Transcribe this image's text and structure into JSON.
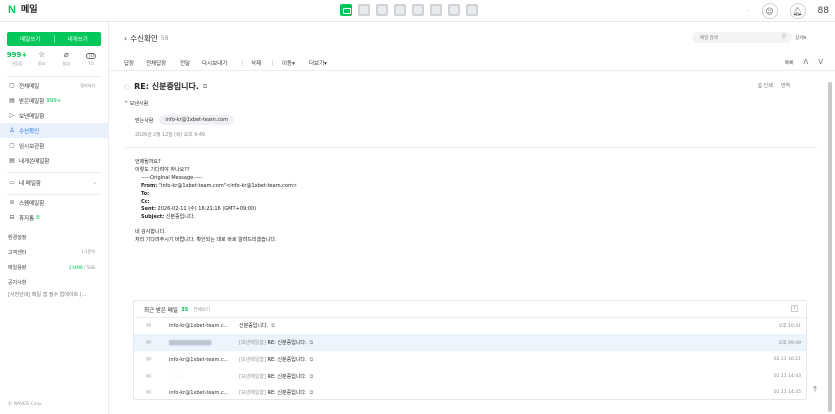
{
  "topbar": {
    "logo_letter": "N",
    "logo_text": "메일",
    "apps": [
      "mail-icon",
      "calendar-icon",
      "note-icon",
      "contacts-icon",
      "drive-icon",
      "memo-icon",
      "board-icon",
      "bookmark-icon"
    ],
    "right_dot": "·",
    "chat_icon": "☺",
    "bell_icon": "♫",
    "grid_icon": "88"
  },
  "sidebar": {
    "write_label": "메일쓰기",
    "self_write_label": "내게쓰기",
    "quick": [
      {
        "value": "999+",
        "label": "안읽음"
      },
      {
        "value": "☆",
        "label": "중요"
      },
      {
        "value": "⌀",
        "label": "첨부"
      },
      {
        "value": "TO",
        "label": "TO"
      }
    ],
    "items": [
      {
        "icon": "▢",
        "label": "전체메일",
        "right": "정리하기"
      },
      {
        "icon": "▤",
        "label": "받은메일함",
        "count": "999+"
      },
      {
        "icon": "▷",
        "label": "보낸메일함"
      },
      {
        "icon": "♙",
        "label": "수신확인"
      },
      {
        "icon": "▢",
        "label": "임시보관함"
      },
      {
        "icon": "▤",
        "label": "내게쓴메일함"
      }
    ],
    "my_folder": {
      "icon": "▭",
      "label": "내 메일함"
    },
    "items2": [
      {
        "icon": "⊘",
        "label": "스팸메일함"
      },
      {
        "icon": "⊟",
        "label": "휴지통",
        "count": "8"
      }
    ],
    "plain": [
      {
        "label": "환경설정"
      },
      {
        "label": "고객센터",
        "right": "1:1문의"
      },
      {
        "label": "메일용량",
        "right_green": "234MB",
        "right_rest": " / 5GB"
      },
      {
        "label": "공지사항"
      },
      {
        "label": "[사전안내] 메일 앱 필수 업데이트 (..."
      }
    ],
    "copyright": "© NAVER Corp."
  },
  "main": {
    "folder_title": "수신확인",
    "folder_count": "58",
    "search_placeholder": "메일 검색",
    "detail_label": "상세▾",
    "toolbar": [
      "답장",
      "전체답장",
      "전달",
      "다시보내기",
      "삭제",
      "이동▾",
      "더보기▾"
    ],
    "list_label": "목록",
    "subject": "RE: 신분증입니다.",
    "print_label": "인쇄",
    "translate_label": "번역",
    "sender_toggle": "보낸사람",
    "recipient_label": "받는사람",
    "recipient": "info-kr@1xbet-team.com",
    "date": "2026년 2월 12일 (목) 오후 9:49",
    "body": {
      "line1": "언제될까요?",
      "line2": "이렇도 기다려야 하나요??",
      "orig": "-----Original Message-----",
      "from_label": "From:",
      "from_value": " \"info-kr@1xbet-team.com\"<info-kr@1xbet-team.com>",
      "to_label": "To:",
      "cc_label": "Cc:",
      "sent_label": "Sent:",
      "sent_value": " 2026-02-11 (수) 16:21:16 (GMT+09:00)",
      "subject_label": "Subject:",
      "subject_value": " 신분증입니다.",
      "reply1": "네 감사합니다.",
      "reply2": "처리 기다려주시기 바랍니다. 확인되는 대로 바로 알려드리겠습니다."
    },
    "recent": {
      "title": "최근 받은 메일",
      "count": "35",
      "all": "전체보기",
      "help": "?",
      "rows": [
        {
          "from": "info-kr@1xbet-team.c...",
          "tag": "",
          "subject": "신분증입니다.",
          "time": "오후 10:41",
          "blur": false,
          "selected": false
        },
        {
          "from": "",
          "tag": "[보낸메일함]",
          "subject": "RE: 신분증입니다.",
          "time": "오후 09:49",
          "blur": true,
          "selected": true
        },
        {
          "from": "info-kr@1xbet-team.c...",
          "tag": "[보낸메일함]",
          "subject": "RE: 신분증입니다.",
          "time": "02.11 16:21",
          "blur": false,
          "selected": false
        },
        {
          "from": "· · · · ·",
          "tag": "[보낸메일함]",
          "subject": "RE: 신분증입니다.",
          "time": "02.11 14:43",
          "blur": true,
          "selected": false
        },
        {
          "from": "info-kr@1xbet-team.c...",
          "tag": "[보낸메일함]",
          "subject": "RE: 신분증입니다.",
          "time": "02.11 14:35",
          "blur": false,
          "selected": false
        }
      ]
    }
  },
  "colors": {
    "brand": "#03c75a",
    "selected": "#e8f1fb",
    "link": "#1a73e8"
  }
}
